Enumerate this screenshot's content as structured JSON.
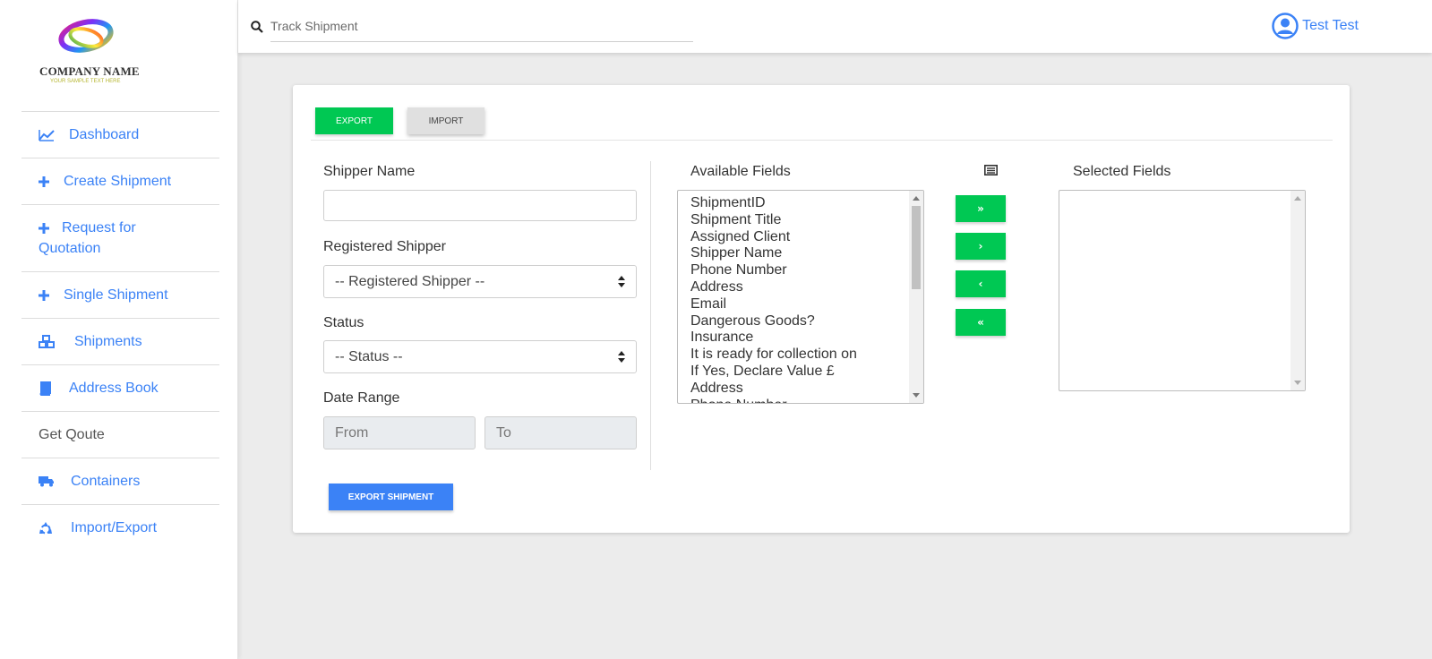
{
  "brand": {
    "company_name": "COMPANY NAME",
    "tagline": "YOUR SAMPLE TEXT HERE"
  },
  "sidebar": {
    "items": [
      {
        "label": "Dashboard",
        "icon": "chart-line-icon"
      },
      {
        "label": "Create Shipment",
        "icon": "plus-icon"
      },
      {
        "label": "Request for Quotation",
        "icon": "plus-icon"
      },
      {
        "label": "Single Shipment",
        "icon": "plus-icon"
      },
      {
        "label": "Shipments",
        "icon": "cubes-icon"
      },
      {
        "label": "Address Book",
        "icon": "book-icon"
      },
      {
        "label": "Get Qoute",
        "icon": ""
      },
      {
        "label": "Containers",
        "icon": "truck-icon"
      },
      {
        "label": "Import/Export",
        "icon": "recycle-icon"
      }
    ]
  },
  "topbar": {
    "search_placeholder": "Track Shipment",
    "user_name": "Test Test"
  },
  "tabs": {
    "export": "EXPORT",
    "import": "IMPORT"
  },
  "form": {
    "shipper_name_label": "Shipper Name",
    "shipper_name_value": "",
    "registered_shipper_label": "Registered Shipper",
    "registered_shipper_value": "-- Registered Shipper --",
    "status_label": "Status",
    "status_value": "-- Status --",
    "date_range_label": "Date Range",
    "from_placeholder": "From",
    "to_placeholder": "To",
    "export_button": "EXPORT SHIPMENT"
  },
  "fields": {
    "available_label": "Available Fields",
    "selected_label": "Selected Fields",
    "available": [
      "ShipmentID",
      "Shipment Title",
      "Assigned Client",
      "Shipper Name",
      "Phone Number",
      "Address",
      "Email",
      "Dangerous Goods?",
      "Insurance",
      "It is ready for collection on",
      "If Yes, Declare Value £",
      "Address",
      "Phone Number"
    ],
    "selected": [],
    "move_buttons": [
      "»",
      "›",
      "‹",
      "«"
    ]
  },
  "colors": {
    "accent_blue": "#3b82f6",
    "green": "#00c853"
  }
}
